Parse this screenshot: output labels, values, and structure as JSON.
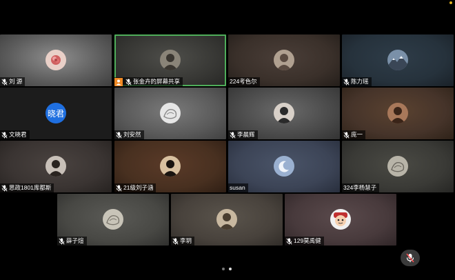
{
  "participants": [
    {
      "name": "刘 源",
      "bg": "radial-gradient(ellipse at 50% 45%, #8e8e8e, #5c5c5c 60%, #3e3e3e)",
      "avatar": "rose-photo",
      "avatar_bg": "#e9d0c8",
      "avatar_fg": "#d06060",
      "muted": true
    },
    {
      "name": "张金卉的屏幕共享",
      "bg": "radial-gradient(ellipse at 50% 45%, #4e4e4a, #373734 60%, #262624)",
      "avatar": "profile-photo",
      "avatar_bg": "#8a8478",
      "avatar_fg": "#3a3630",
      "muted": true,
      "sharing": true,
      "active": true
    },
    {
      "name": "224考色尔",
      "bg": "radial-gradient(ellipse at 50% 45%, #4a3e38, #3a302a 60%, #241e1a)",
      "avatar": "person-photo",
      "avatar_bg": "#b0a090",
      "avatar_fg": "#5a4a40",
      "muted": false
    },
    {
      "name": "陈力瑶",
      "bg": "radial-gradient(ellipse at 50% 45%, #2e3c48, #26323c 60%, #1a2128)",
      "avatar": "mountain-photo",
      "avatar_bg": "#7a90a8",
      "avatar_fg": "#e8eef4",
      "muted": true
    },
    {
      "name": "文晓君",
      "bg": "#1c1c1c",
      "avatar": "text",
      "avatar_text": "晓君",
      "avatar_bg": "#1f6fe0",
      "avatar_fg": "#ffffff",
      "muted": true
    },
    {
      "name": "刘安然",
      "bg": "radial-gradient(ellipse at 50% 45%, #7a7a7a, #5a5a5a 60%, #404040)",
      "avatar": "sketch-photo",
      "avatar_bg": "#e6e6e6",
      "avatar_fg": "#888888",
      "muted": true
    },
    {
      "name": "李晨辉",
      "bg": "radial-gradient(ellipse at 50% 45%, #6a6a6a, #4a4a4a 60%, #333333)",
      "avatar": "person-photo",
      "avatar_bg": "#d8d0c8",
      "avatar_fg": "#2a2a2a",
      "muted": true
    },
    {
      "name": "庞一",
      "bg": "radial-gradient(ellipse at 50% 45%, #5a4230, #46342a 60%, #2e2218)",
      "avatar": "person-photo",
      "avatar_bg": "#a8785a",
      "avatar_fg": "#3a2418",
      "muted": true
    },
    {
      "name": "思政1801库都斯",
      "bg": "radial-gradient(ellipse at 50% 45%, #4a4340, #3a3432 60%, #262220)",
      "avatar": "person-photo",
      "avatar_bg": "#c8c0b8",
      "avatar_fg": "#2a2420",
      "muted": true
    },
    {
      "name": "21级刘子涵",
      "bg": "radial-gradient(ellipse at 50% 45%, #5a3a28, #483020 60%, #2e1e14)",
      "avatar": "person-photo",
      "avatar_bg": "#d8c0a0",
      "avatar_fg": "#1a1410",
      "muted": true
    },
    {
      "name": "susan",
      "bg": "radial-gradient(ellipse at 50% 45%, #4a5468, #3c4456 60%, #282e3c)",
      "avatar": "moon-photo",
      "avatar_bg": "#9ab0d0",
      "avatar_fg": "#f0f4fa",
      "muted": false
    },
    {
      "name": "324李杨慧子",
      "bg": "radial-gradient(ellipse at 50% 45%, #4a4a44, #3a3a36 60%, #262624)",
      "avatar": "sketch-photo",
      "avatar_bg": "#b8b4a8",
      "avatar_fg": "#6a665e",
      "muted": false
    },
    {
      "name": "薛子煊",
      "bg": "radial-gradient(ellipse at 50% 45%, #5a5a56, #484844 60%, #30302e)",
      "avatar": "sketch-photo",
      "avatar_bg": "#c8c4b8",
      "avatar_fg": "#7a766c",
      "muted": true
    },
    {
      "name": "李玥",
      "bg": "radial-gradient(ellipse at 50% 45%, #5a544c, #48423c 60%, #302c28)",
      "avatar": "person-photo",
      "avatar_bg": "#c8b8a0",
      "avatar_fg": "#4a3e30",
      "muted": true
    },
    {
      "name": "129莫禹健",
      "bg": "radial-gradient(ellipse at 50% 45%, #5a4a4c, #483a3c 60%, #302628)",
      "avatar": "cartoon-photo",
      "avatar_bg": "#f0f0f0",
      "avatar_fg": "#c03030",
      "muted": true
    }
  ],
  "pager": {
    "pages": 2,
    "current": 2
  },
  "controls": {
    "mute_icon": "mic-off-icon"
  },
  "colors": {
    "active_border": "#4fae5a",
    "share_badge": "#f08a24",
    "avatar_text_bg": "#1f6fe0"
  }
}
